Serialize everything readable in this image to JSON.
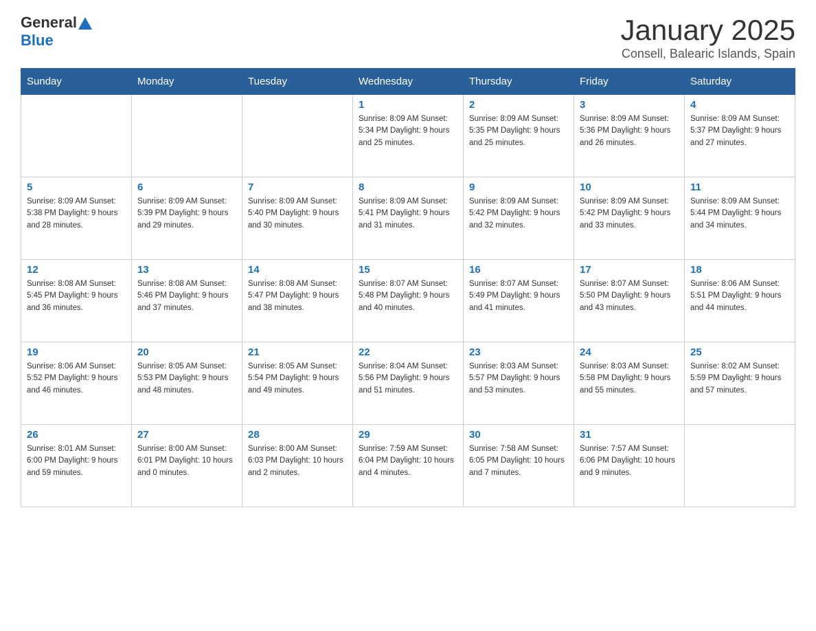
{
  "header": {
    "logo_general": "General",
    "logo_blue": "Blue",
    "title": "January 2025",
    "subtitle": "Consell, Balearic Islands, Spain"
  },
  "days_of_week": [
    "Sunday",
    "Monday",
    "Tuesday",
    "Wednesday",
    "Thursday",
    "Friday",
    "Saturday"
  ],
  "weeks": [
    [
      {
        "day": "",
        "info": ""
      },
      {
        "day": "",
        "info": ""
      },
      {
        "day": "",
        "info": ""
      },
      {
        "day": "1",
        "info": "Sunrise: 8:09 AM\nSunset: 5:34 PM\nDaylight: 9 hours\nand 25 minutes."
      },
      {
        "day": "2",
        "info": "Sunrise: 8:09 AM\nSunset: 5:35 PM\nDaylight: 9 hours\nand 25 minutes."
      },
      {
        "day": "3",
        "info": "Sunrise: 8:09 AM\nSunset: 5:36 PM\nDaylight: 9 hours\nand 26 minutes."
      },
      {
        "day": "4",
        "info": "Sunrise: 8:09 AM\nSunset: 5:37 PM\nDaylight: 9 hours\nand 27 minutes."
      }
    ],
    [
      {
        "day": "5",
        "info": "Sunrise: 8:09 AM\nSunset: 5:38 PM\nDaylight: 9 hours\nand 28 minutes."
      },
      {
        "day": "6",
        "info": "Sunrise: 8:09 AM\nSunset: 5:39 PM\nDaylight: 9 hours\nand 29 minutes."
      },
      {
        "day": "7",
        "info": "Sunrise: 8:09 AM\nSunset: 5:40 PM\nDaylight: 9 hours\nand 30 minutes."
      },
      {
        "day": "8",
        "info": "Sunrise: 8:09 AM\nSunset: 5:41 PM\nDaylight: 9 hours\nand 31 minutes."
      },
      {
        "day": "9",
        "info": "Sunrise: 8:09 AM\nSunset: 5:42 PM\nDaylight: 9 hours\nand 32 minutes."
      },
      {
        "day": "10",
        "info": "Sunrise: 8:09 AM\nSunset: 5:42 PM\nDaylight: 9 hours\nand 33 minutes."
      },
      {
        "day": "11",
        "info": "Sunrise: 8:09 AM\nSunset: 5:44 PM\nDaylight: 9 hours\nand 34 minutes."
      }
    ],
    [
      {
        "day": "12",
        "info": "Sunrise: 8:08 AM\nSunset: 5:45 PM\nDaylight: 9 hours\nand 36 minutes."
      },
      {
        "day": "13",
        "info": "Sunrise: 8:08 AM\nSunset: 5:46 PM\nDaylight: 9 hours\nand 37 minutes."
      },
      {
        "day": "14",
        "info": "Sunrise: 8:08 AM\nSunset: 5:47 PM\nDaylight: 9 hours\nand 38 minutes."
      },
      {
        "day": "15",
        "info": "Sunrise: 8:07 AM\nSunset: 5:48 PM\nDaylight: 9 hours\nand 40 minutes."
      },
      {
        "day": "16",
        "info": "Sunrise: 8:07 AM\nSunset: 5:49 PM\nDaylight: 9 hours\nand 41 minutes."
      },
      {
        "day": "17",
        "info": "Sunrise: 8:07 AM\nSunset: 5:50 PM\nDaylight: 9 hours\nand 43 minutes."
      },
      {
        "day": "18",
        "info": "Sunrise: 8:06 AM\nSunset: 5:51 PM\nDaylight: 9 hours\nand 44 minutes."
      }
    ],
    [
      {
        "day": "19",
        "info": "Sunrise: 8:06 AM\nSunset: 5:52 PM\nDaylight: 9 hours\nand 46 minutes."
      },
      {
        "day": "20",
        "info": "Sunrise: 8:05 AM\nSunset: 5:53 PM\nDaylight: 9 hours\nand 48 minutes."
      },
      {
        "day": "21",
        "info": "Sunrise: 8:05 AM\nSunset: 5:54 PM\nDaylight: 9 hours\nand 49 minutes."
      },
      {
        "day": "22",
        "info": "Sunrise: 8:04 AM\nSunset: 5:56 PM\nDaylight: 9 hours\nand 51 minutes."
      },
      {
        "day": "23",
        "info": "Sunrise: 8:03 AM\nSunset: 5:57 PM\nDaylight: 9 hours\nand 53 minutes."
      },
      {
        "day": "24",
        "info": "Sunrise: 8:03 AM\nSunset: 5:58 PM\nDaylight: 9 hours\nand 55 minutes."
      },
      {
        "day": "25",
        "info": "Sunrise: 8:02 AM\nSunset: 5:59 PM\nDaylight: 9 hours\nand 57 minutes."
      }
    ],
    [
      {
        "day": "26",
        "info": "Sunrise: 8:01 AM\nSunset: 6:00 PM\nDaylight: 9 hours\nand 59 minutes."
      },
      {
        "day": "27",
        "info": "Sunrise: 8:00 AM\nSunset: 6:01 PM\nDaylight: 10 hours\nand 0 minutes."
      },
      {
        "day": "28",
        "info": "Sunrise: 8:00 AM\nSunset: 6:03 PM\nDaylight: 10 hours\nand 2 minutes."
      },
      {
        "day": "29",
        "info": "Sunrise: 7:59 AM\nSunset: 6:04 PM\nDaylight: 10 hours\nand 4 minutes."
      },
      {
        "day": "30",
        "info": "Sunrise: 7:58 AM\nSunset: 6:05 PM\nDaylight: 10 hours\nand 7 minutes."
      },
      {
        "day": "31",
        "info": "Sunrise: 7:57 AM\nSunset: 6:06 PM\nDaylight: 10 hours\nand 9 minutes."
      },
      {
        "day": "",
        "info": ""
      }
    ]
  ]
}
